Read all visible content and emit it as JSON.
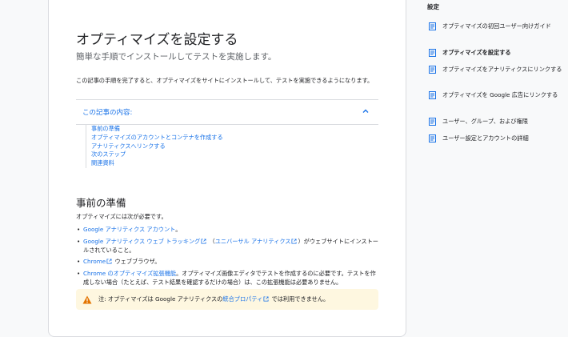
{
  "article": {
    "title": "オプティマイズを設定する",
    "subtitle": "簡単な手順でインストールしてテストを実施します。",
    "intro": "この記事の手順を完了すると、オプティマイズをサイトにインストールして、テストを実施できるようになります。",
    "toc": {
      "title": "この記事の内容:",
      "items": [
        "事前の準備",
        "オプティマイズのアカウントとコンテナを作成する",
        "アナリティクスへリンクする",
        "次のステップ",
        "関連資料"
      ]
    },
    "section_heading": "事前の準備",
    "requirements_intro": "オプティマイズには次が必要です。",
    "bullets": {
      "b1_link": "Google アナリティクス アカウント",
      "b1_after": "。",
      "b2_link1": "Google アナリティクス ウェブ トラッキング",
      "b2_mid": " （",
      "b2_link2": "ユニバーサル アナリティクス",
      "b2_after": "）がウェブサイトにインストールされていること。",
      "b3_link": "Chrome",
      "b3_after": " ウェブブラウザ。",
      "b4_link": "Chrome のオプティマイズ拡張機能",
      "b4_after": "。オプティマイズ画像エディタでテストを作成するのに必要です。テストを作成しない場合（たとえば、テスト結果を確認するだけの場合）は、この拡張機能は必要ありません。"
    },
    "note": {
      "before": "注: オプティマイズは Google アナリティクスの",
      "link": "統合プロパティ",
      "after": " では利用できません。"
    }
  },
  "sidebar": {
    "title": "設定",
    "items": [
      {
        "label": "オプティマイズの初回ユーザー向けガイド"
      },
      {
        "label": "オプティマイズを設定する"
      },
      {
        "label": "オプティマイズをアナリティクスにリンクする"
      },
      {
        "label": "オプティマイズを Google 広告にリンクする"
      },
      {
        "label": "ユーザー、グループ、および権限"
      },
      {
        "label": "ユーザー設定とアカウントの詳細"
      }
    ]
  },
  "icons": {
    "toc_chevron": "chevron-up-icon",
    "external_link": "external-link-icon",
    "warning": "warning-icon",
    "sidebar_doc": "document-icon"
  },
  "colors": {
    "link": "#1a73e8",
    "note_background": "#fef7e0",
    "warning": "#e37400"
  }
}
